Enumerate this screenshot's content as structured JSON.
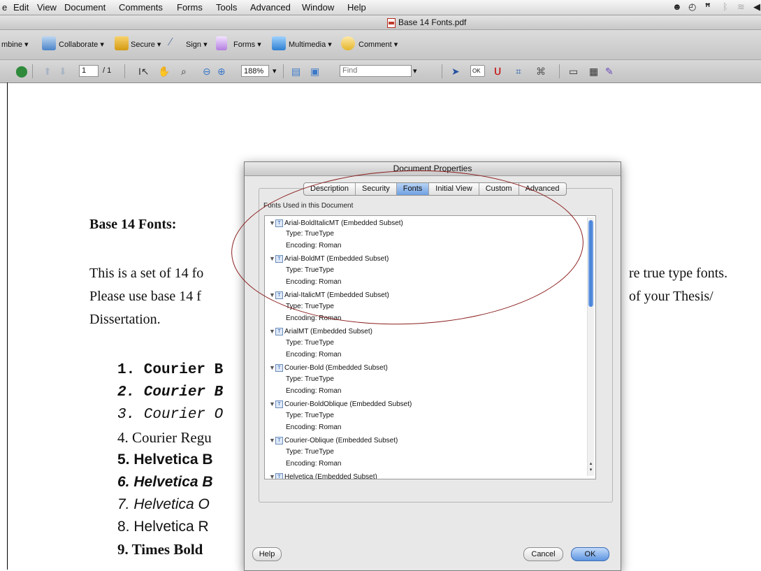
{
  "menubar": {
    "items": [
      "e",
      "Edit",
      "View",
      "Document",
      "Comments",
      "Forms",
      "Tools",
      "Advanced",
      "Window",
      "Help"
    ],
    "icons": [
      "robot-icon",
      "time-machine-icon",
      "binoculars-icon",
      "bluetooth-icon",
      "wifi-icon",
      "volume-icon"
    ]
  },
  "window": {
    "title": "Base 14 Fonts.pdf"
  },
  "taskbar": {
    "items": [
      "mbine ▾",
      "Collaborate ▾",
      "Secure ▾",
      "Sign ▾",
      "Forms ▾",
      "Multimedia ▾",
      "Comment ▾"
    ]
  },
  "navbar": {
    "page_value": "1",
    "page_total": "/ 1",
    "zoom": "188%",
    "find_placeholder": "Find",
    "ok_button": "OK"
  },
  "document": {
    "heading": "Base 14 Fonts:",
    "para_lines": [
      "This is a set of 14 fo",
      "Please use base 14 f",
      "Dissertation."
    ],
    "para_right": [
      "re true type fonts.",
      "of your Thesis/"
    ],
    "list": [
      "1. Courier B",
      "2. Courier B",
      "3. Courier O",
      "4. Courier Regu",
      "5. Helvetica B",
      "6. Helvetica B",
      "7. Helvetica O",
      "8. Helvetica R",
      "9. Times Bold"
    ]
  },
  "dialog": {
    "title": "Document Properties",
    "tabs": [
      "Description",
      "Security",
      "Fonts",
      "Initial View",
      "Custom",
      "Advanced"
    ],
    "active_tab": "Fonts",
    "group_label": "Fonts Used in this Document",
    "fonts": [
      {
        "name": "Arial-BoldItalicMT (Embedded Subset)",
        "type": "Type: TrueType",
        "encoding": "Encoding: Roman"
      },
      {
        "name": "Arial-BoldMT (Embedded Subset)",
        "type": "Type: TrueType",
        "encoding": "Encoding: Roman"
      },
      {
        "name": "Arial-ItalicMT (Embedded Subset)",
        "type": "Type: TrueType",
        "encoding": "Encoding: Roman"
      },
      {
        "name": "ArialMT (Embedded Subset)",
        "type": "Type: TrueType",
        "encoding": "Encoding: Roman"
      },
      {
        "name": "Courier-Bold (Embedded Subset)",
        "type": "Type: TrueType",
        "encoding": "Encoding: Roman"
      },
      {
        "name": "Courier-BoldOblique (Embedded Subset)",
        "type": "Type: TrueType",
        "encoding": "Encoding: Roman"
      },
      {
        "name": "Courier-Oblique (Embedded Subset)",
        "type": "Type: TrueType",
        "encoding": "Encoding: Roman"
      },
      {
        "name": "Helvetica (Embedded Subset)",
        "type": "",
        "encoding": ""
      }
    ],
    "help_button": "Help",
    "cancel_button": "Cancel",
    "ok_button": "OK"
  },
  "colors": {
    "annotation_ellipse": "#8b1d1d",
    "active_tab": "#6fa0e2",
    "pdf_icon": "#c0392b"
  }
}
